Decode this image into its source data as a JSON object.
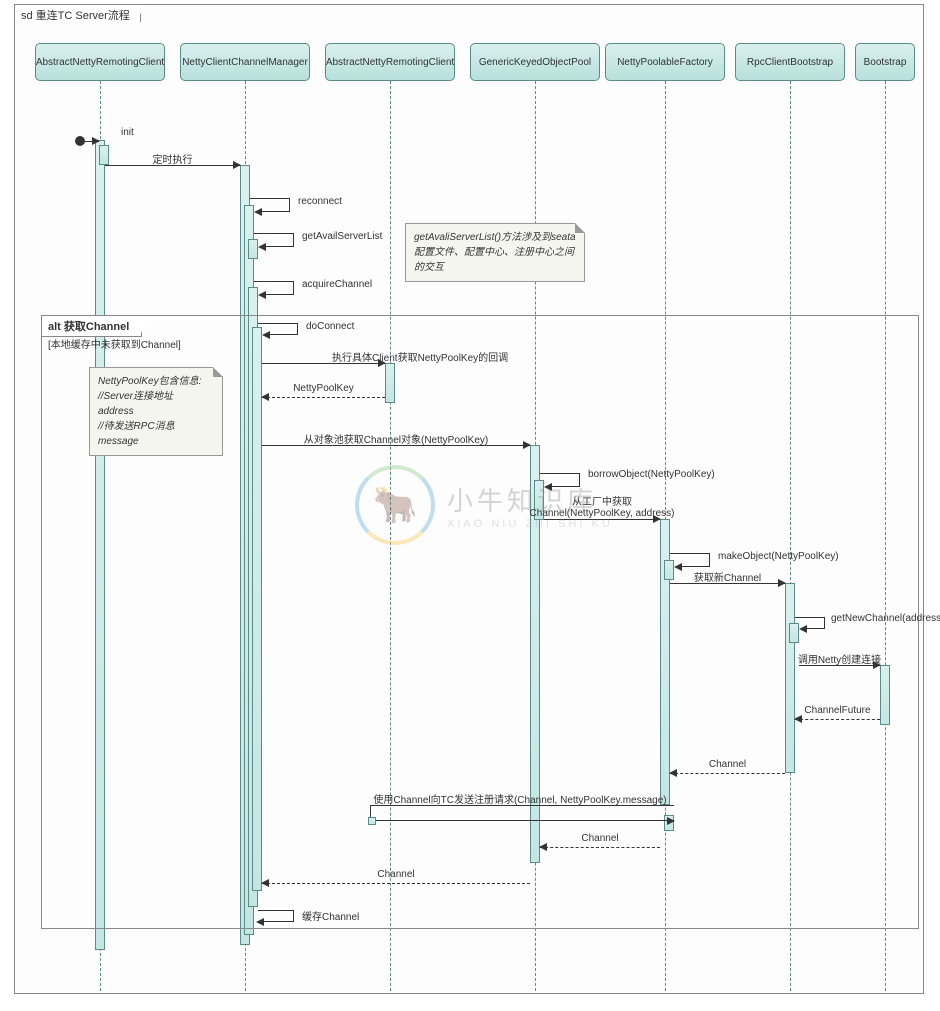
{
  "diagram": {
    "title": "sd 重连TC Server流程",
    "participants": [
      "AbstractNettyRemotingClient",
      "NettyClientChannelManager",
      "AbstractNettyRemotingClient",
      "GenericKeyedObjectPool",
      "NettyPoolableFactory",
      "RpcClientBootstrap",
      "Bootstrap"
    ],
    "alt": {
      "label": "alt 获取Channel",
      "guard": "[本地缓存中未获取到Channel]"
    },
    "messages": {
      "init": "init",
      "timer": "定时执行",
      "reconnect": "reconnect",
      "getAvailServerList": "getAvailServerList",
      "acquireChannel": "acquireChannel",
      "doConnect": "doConnect",
      "callback": "执行具体Client获取NettyPoolKey的回调",
      "nettyPoolKey": "NettyPoolKey",
      "fromPool": "从对象池获取Channel对象(NettyPoolKey)",
      "borrowObject": "borrowObject(NettyPoolKey)",
      "fromFactory": "从工厂中获取Channel(NettyPoolKey, address)",
      "makeObject": "makeObject(NettyPoolKey)",
      "getNewChannel_label": "获取新Channel",
      "getNewChannel": "getNewChannel(address)",
      "callNetty": "调用Netty创建连接",
      "channelFuture": "ChannelFuture",
      "channel": "Channel",
      "register": "使用Channel向TC发送注册请求(Channel, NettyPoolKey.message)",
      "cacheChannel": "缓存Channel"
    },
    "notes": {
      "note1": "getAvaliServerList()方法涉及到seata配置文件、配置中心、注册中心之间的交互",
      "note2_l1": "NettyPoolKey包含信息:",
      "note2_l2": "//Server连接地址",
      "note2_l3": "address",
      "note2_l4": "//待发送RPC消息",
      "note2_l5": "message"
    }
  },
  "watermark": {
    "main": "小牛知识库",
    "sub": "XIAO NIU ZHI SHI KU"
  }
}
